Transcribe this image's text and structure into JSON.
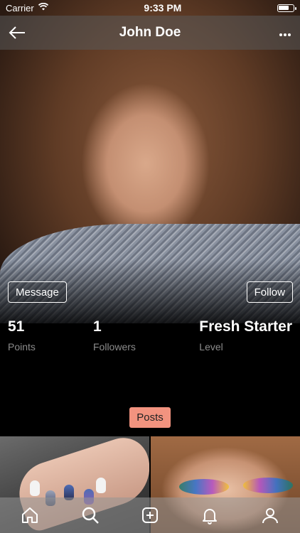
{
  "status_bar": {
    "carrier": "Carrier",
    "time": "9:33 PM"
  },
  "nav": {
    "title": "John Doe",
    "back_icon": "arrow-left-icon",
    "more_icon": "more-horizontal-icon"
  },
  "profile": {
    "message_label": "Message",
    "follow_label": "Follow",
    "stats": [
      {
        "value": "51",
        "label": "Points"
      },
      {
        "value": "1",
        "label": "Followers"
      },
      {
        "value": "Fresh Starter",
        "label": "Level"
      }
    ]
  },
  "tabs": {
    "posts_label": "Posts",
    "accent_color": "#f2937f"
  },
  "bottom_nav": {
    "items": [
      "home-icon",
      "search-icon",
      "add-post-icon",
      "notifications-icon",
      "profile-icon"
    ]
  }
}
